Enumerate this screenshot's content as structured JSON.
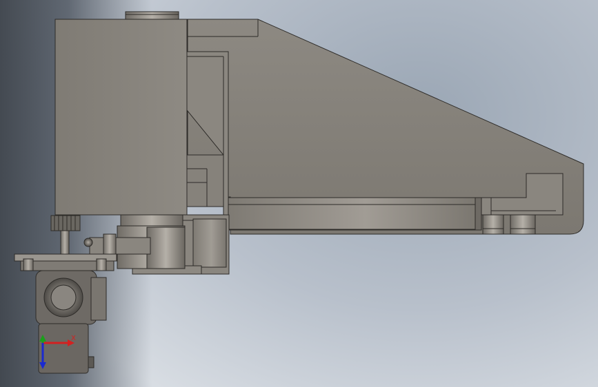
{
  "viewport": {
    "background_top": "#9aa6b4",
    "background_bottom": "#d8dde3",
    "part_color": "#8a8680",
    "edge_color": "#2d2b28"
  },
  "triad": {
    "x_label": "X",
    "x_color": "#d42020",
    "y_color": "#1aa01a",
    "z_color": "#1a2ad0"
  }
}
